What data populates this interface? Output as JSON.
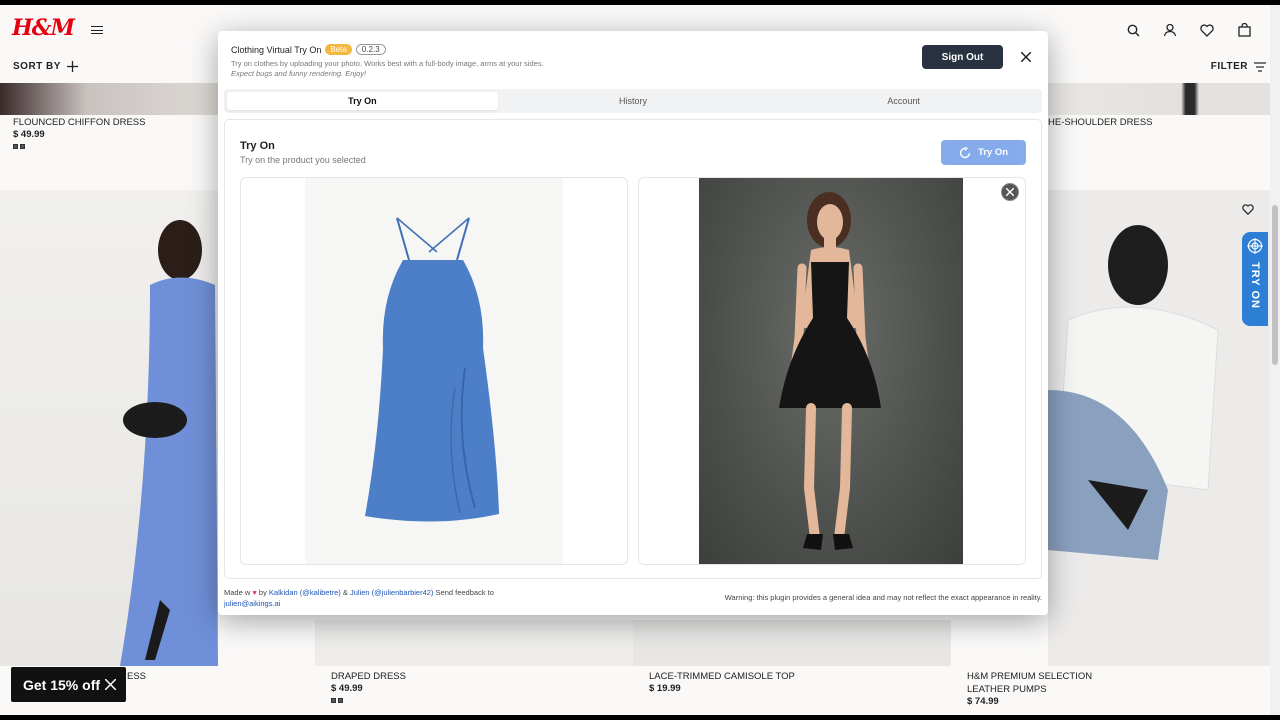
{
  "store": {
    "logo": "H&M",
    "sort_label": "SORT BY",
    "filter_label": "FILTER",
    "products_top": [
      {
        "name": "FLOUNCED CHIFFON DRESS",
        "price": "$ 49.99"
      },
      {
        "name": "HE-SHOULDER DRESS",
        "price": ""
      }
    ],
    "products_bottom": [
      {
        "name": "ESS",
        "price": ""
      },
      {
        "name": "DRAPED DRESS",
        "price": "$ 49.99"
      },
      {
        "name": "LACE-TRIMMED CAMISOLE TOP",
        "price": "$ 19.99"
      },
      {
        "name": "H&M PREMIUM SELECTION",
        "name2": "LEATHER PUMPS",
        "price": "$ 74.99"
      }
    ],
    "tryon_tab_label": "TRY ON",
    "promo": "Get 15% off"
  },
  "modal": {
    "title": "Clothing Virtual Try On",
    "beta": "Beta",
    "version": "0.2.3",
    "description": "Try on clothes by uploading your photo. Works best with a full-body image, arms at your sides.",
    "description2": "Expect bugs and funny rendering. Enjoy!",
    "sign_out": "Sign Out",
    "tabs": [
      "Try On",
      "History",
      "Account"
    ],
    "panel_title": "Try On",
    "panel_subtitle": "Try on the product you selected",
    "tryon_button": "Try On",
    "footer": {
      "made_with": "Made w",
      "by": "by",
      "author1": "Kalkidan (@kalibetre)",
      "amp": "&",
      "author2": "Julien (@julienbarbier42)",
      "feedback": "Send feedback to",
      "email": "julien@aikings.ai",
      "warning": "Warning: this plugin provides a general idea and may not reflect the exact appearance in reality."
    }
  },
  "colors": {
    "brand_red": "#e50010",
    "signout_bg": "#283241",
    "tryon_btn": "#7aa2ea",
    "tryon_tab": "#2d7fd6"
  }
}
